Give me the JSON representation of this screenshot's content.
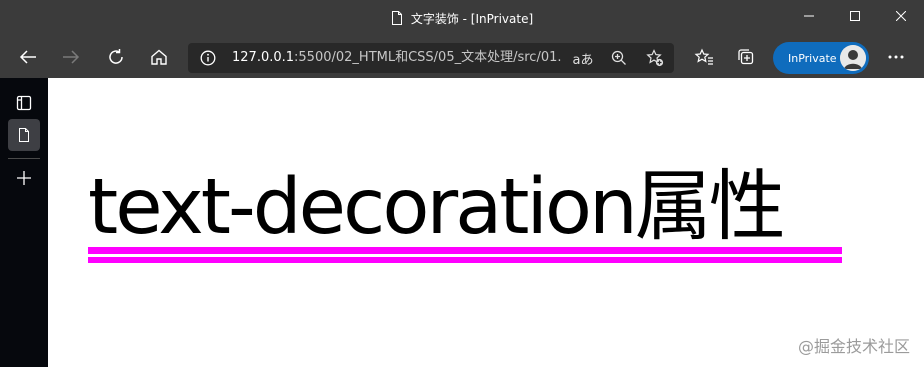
{
  "window": {
    "title": "文字装饰 - [InPrivate]"
  },
  "toolbar": {
    "url_host": "127.0.0.1",
    "url_rest": ":5500/02_HTML和CSS/05_文本处理/src/01...",
    "read_aloud_label": "aあ",
    "inprivate_label": "InPrivate"
  },
  "page": {
    "heading": "text-decoration属性",
    "underline_color": "#ff00ff"
  },
  "watermark": "@掘金技术社区",
  "colors": {
    "chrome": "#3b3b3b",
    "addressbar": "#282828",
    "sidebar": "#06080d",
    "inprivate": "#0f6cbd"
  }
}
